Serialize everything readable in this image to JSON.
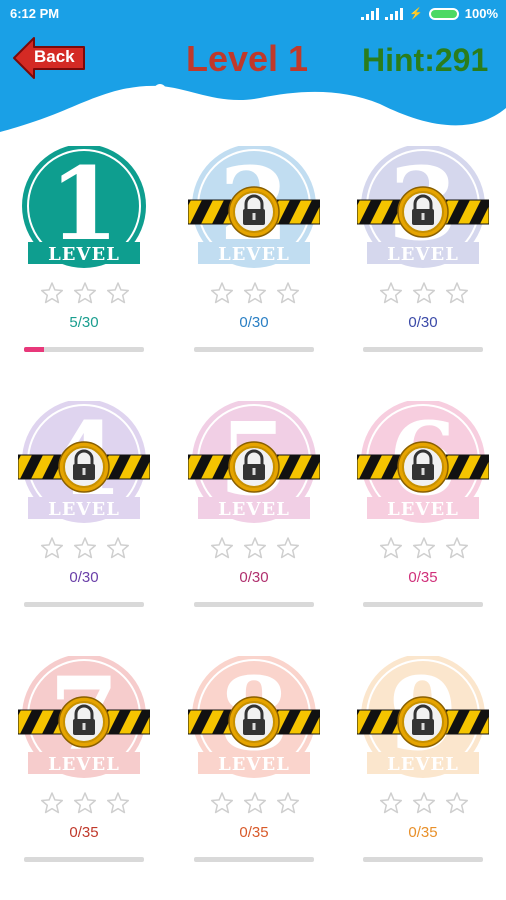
{
  "status_bar": {
    "time": "6:12 PM",
    "battery": "100%"
  },
  "header": {
    "back_label": "Back",
    "title": "Level 1",
    "hint": "Hint:291"
  },
  "badge_word": "LEVEL",
  "levels": [
    {
      "number": "1",
      "progress": "5/30",
      "fraction": 0.1667,
      "locked": false,
      "color": "#0e9e8f"
    },
    {
      "number": "2",
      "progress": "0/30",
      "fraction": 0,
      "locked": true,
      "color": "#8fc3e6"
    },
    {
      "number": "3",
      "progress": "0/30",
      "fraction": 0,
      "locked": true,
      "color": "#b3b7e0"
    },
    {
      "number": "4",
      "progress": "0/30",
      "fraction": 0,
      "locked": true,
      "color": "#c6b2e2"
    },
    {
      "number": "5",
      "progress": "0/30",
      "fraction": 0,
      "locked": true,
      "color": "#e6a9d0"
    },
    {
      "number": "6",
      "progress": "0/35",
      "fraction": 0,
      "locked": true,
      "color": "#f2a7c6"
    },
    {
      "number": "7",
      "progress": "0/35",
      "fraction": 0,
      "locked": true,
      "color": "#f0a3a3"
    },
    {
      "number": "8",
      "progress": "0/35",
      "fraction": 0,
      "locked": true,
      "color": "#f6b1a3"
    },
    {
      "number": "9",
      "progress": "0/35",
      "fraction": 0,
      "locked": true,
      "color": "#f8d2a6"
    }
  ],
  "progress_text_colors": [
    "#1a9e8f",
    "#2a7fc4",
    "#3b4aa8",
    "#6a3fa8",
    "#b0306e",
    "#d0307a",
    "#c0392b",
    "#d85a2a",
    "#e8902a"
  ]
}
